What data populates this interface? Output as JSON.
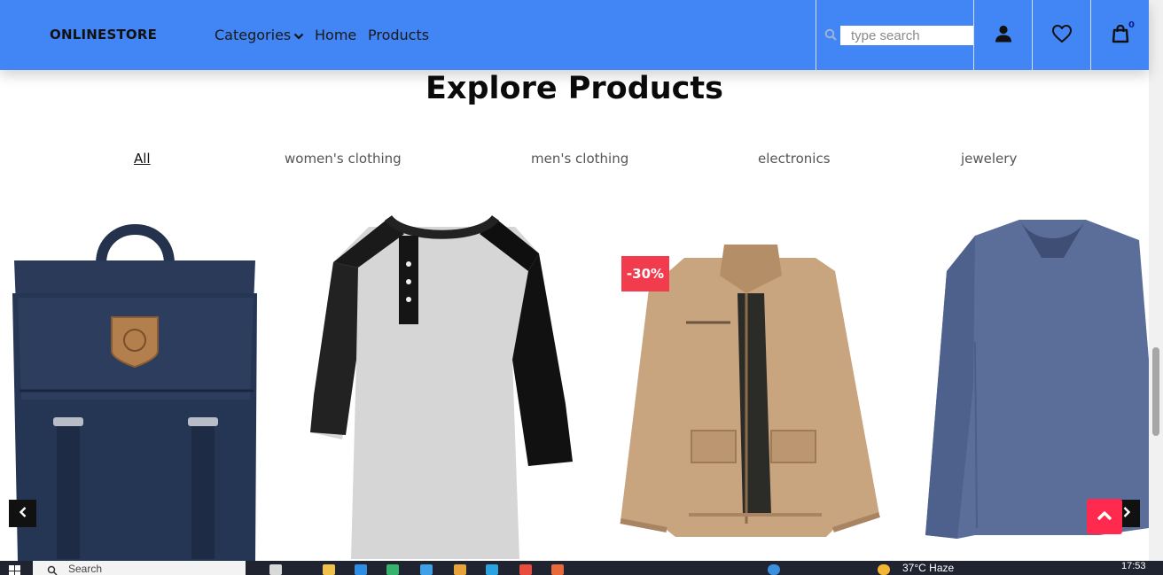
{
  "navbar": {
    "brand": "ONLINESTORE",
    "links": {
      "categories": "Categories",
      "home": "Home",
      "products": "Products"
    },
    "search_placeholder": "type search",
    "cart_count": "0"
  },
  "section_title": "Explore Products",
  "filters": {
    "all": "All",
    "womens": "women's clothing",
    "mens": "men's clothing",
    "electronics": "electronics",
    "jewelery": "jewelery"
  },
  "products": {
    "jacket_discount": "-30%"
  },
  "icons": {
    "search": "search-icon",
    "user": "user-icon",
    "heart": "heart-icon",
    "cart": "shopping-bag-icon",
    "prev": "chevron-left-icon",
    "next": "chevron-right-icon",
    "scroll_top": "chevron-up-icon"
  },
  "colors": {
    "navbar": "#4285f4",
    "badge": "#f23b4c",
    "scroll_top": "#ff2a4e"
  },
  "taskbar": {
    "search_label": "Search",
    "weather": "37°C  Haze",
    "time": "17:53"
  }
}
